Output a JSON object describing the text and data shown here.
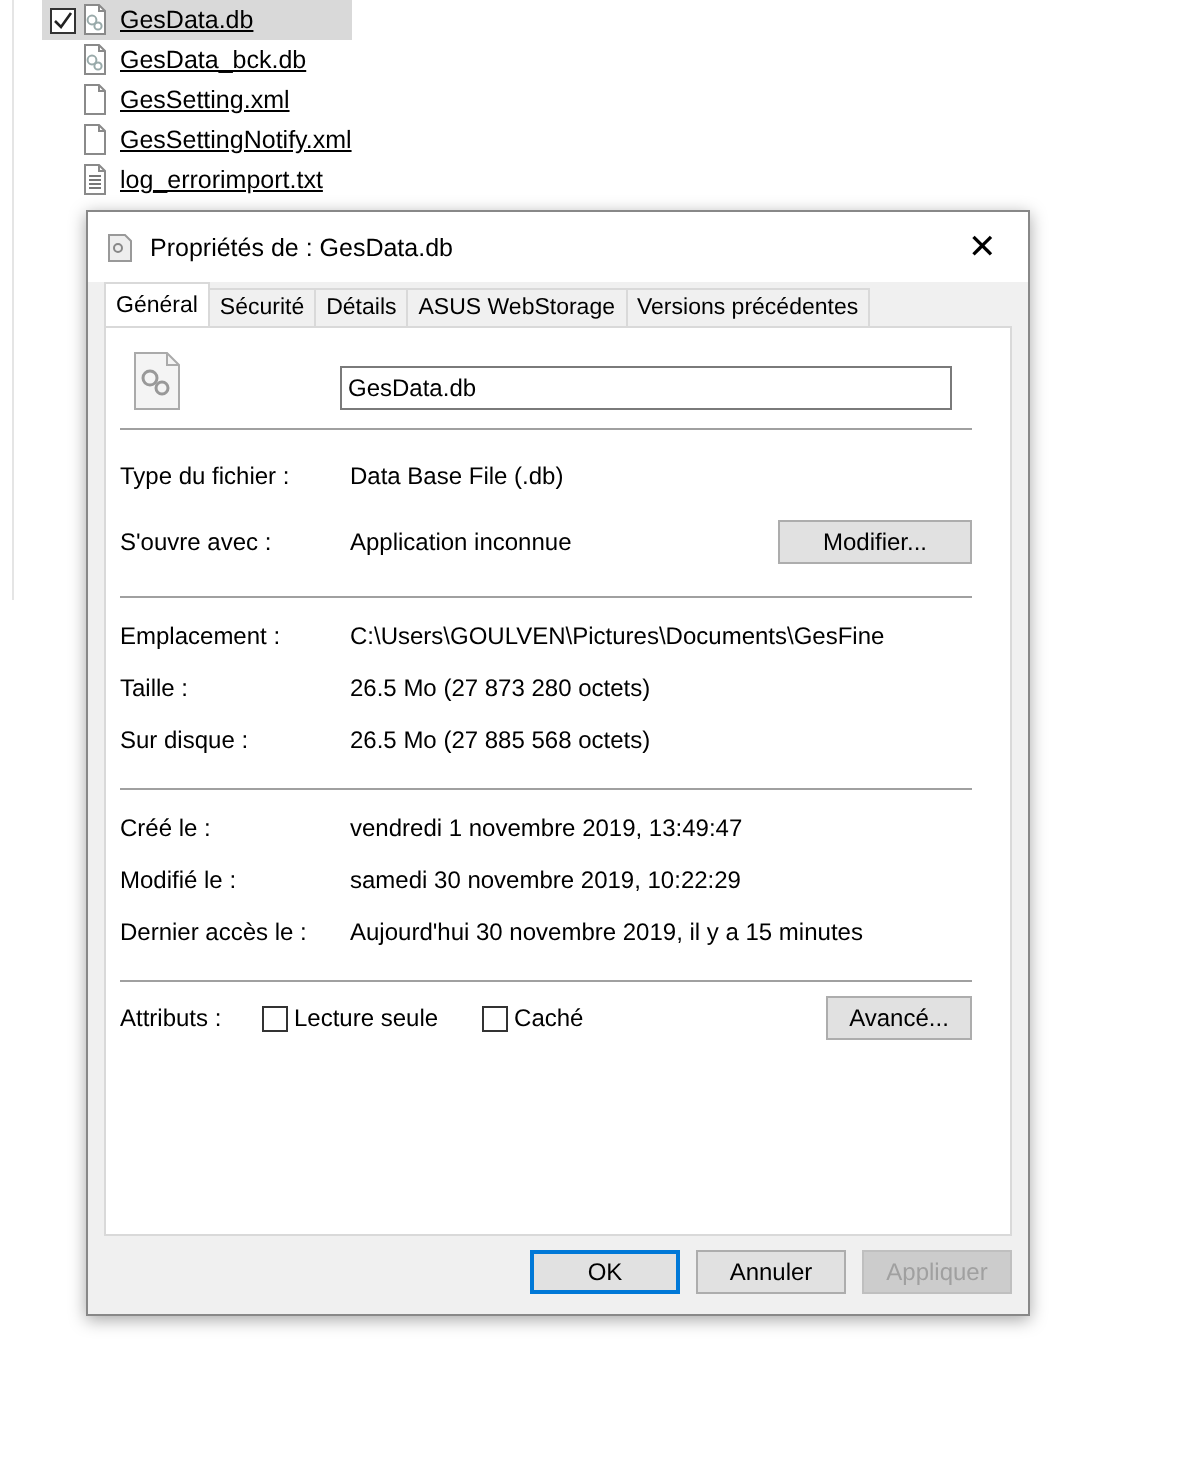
{
  "files": [
    {
      "name": "GesData.db",
      "kind": "db",
      "selected": true
    },
    {
      "name": "GesData_bck.db",
      "kind": "db",
      "selected": false
    },
    {
      "name": "GesSetting.xml",
      "kind": "file",
      "selected": false
    },
    {
      "name": "GesSettingNotify.xml",
      "kind": "file",
      "selected": false
    },
    {
      "name": "log_errorimport.txt",
      "kind": "text",
      "selected": false
    }
  ],
  "dialog": {
    "title": "Propriétés de : GesData.db",
    "close": "✕",
    "tabs": [
      {
        "label": "Général",
        "selected": true
      },
      {
        "label": "Sécurité",
        "selected": false
      },
      {
        "label": "Détails",
        "selected": false
      },
      {
        "label": "ASUS WebStorage",
        "selected": false
      },
      {
        "label": "Versions précédentes",
        "selected": false
      }
    ],
    "name_field": "GesData.db",
    "sections": [
      [
        {
          "label": "Type du fichier :",
          "value": "Data Base File (.db)"
        },
        {
          "label": "S'ouvre avec :",
          "value": "Application inconnue",
          "button": "Modifier..."
        }
      ],
      [
        {
          "label": "Emplacement :",
          "value": "C:\\Users\\GOULVEN\\Pictures\\Documents\\GesFine"
        },
        {
          "label": "Taille :",
          "value": "26.5 Mo (27 873 280 octets)"
        },
        {
          "label": "Sur disque :",
          "value": "26.5 Mo (27 885 568 octets)"
        }
      ],
      [
        {
          "label": "Créé le :",
          "value": "vendredi 1 novembre 2019, 13:49:47"
        },
        {
          "label": "Modifié le :",
          "value": "samedi 30 novembre 2019, 10:22:29"
        },
        {
          "label": "Dernier accès le :",
          "value": "Aujourd'hui 30 novembre 2019, il y a 15 minutes"
        }
      ]
    ],
    "attributes": {
      "label": "Attributs :",
      "checkboxes": [
        {
          "label": "Lecture seule",
          "checked": false
        },
        {
          "label": "Caché",
          "checked": false
        }
      ],
      "button": "Avancé..."
    },
    "buttons": [
      {
        "label": "OK",
        "kind": "default"
      },
      {
        "label": "Annuler",
        "kind": "normal"
      },
      {
        "label": "Appliquer",
        "kind": "disabled"
      }
    ]
  }
}
